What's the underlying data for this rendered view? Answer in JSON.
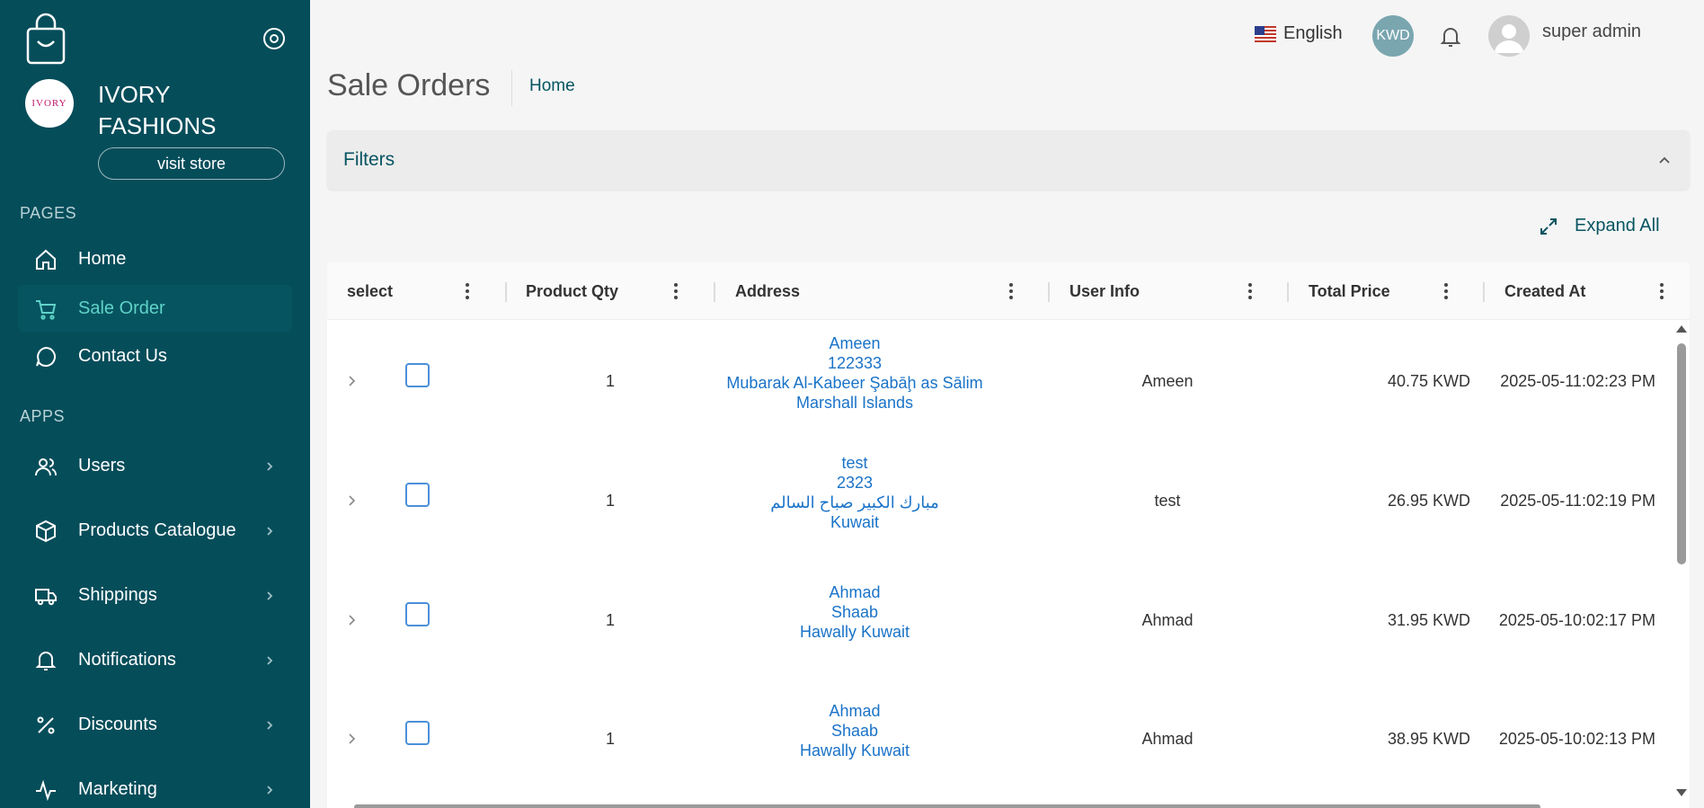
{
  "sidebar": {
    "brand_logo_text": "IVORY",
    "brand_name": "IVORY FASHIONS",
    "visit_store": "visit store",
    "pages_label": "PAGES",
    "apps_label": "APPS",
    "pages": [
      {
        "label": "Home",
        "icon": "home-icon"
      },
      {
        "label": "Sale Order",
        "icon": "cart-icon",
        "active": true
      },
      {
        "label": "Contact Us",
        "icon": "chat-icon"
      }
    ],
    "apps": [
      {
        "label": "Users",
        "icon": "users-icon"
      },
      {
        "label": "Products Catalogue",
        "icon": "box-icon"
      },
      {
        "label": "Shippings",
        "icon": "truck-icon"
      },
      {
        "label": "Notifications",
        "icon": "bell-icon"
      },
      {
        "label": "Discounts",
        "icon": "percent-icon"
      },
      {
        "label": "Marketing",
        "icon": "activity-icon"
      }
    ]
  },
  "header": {
    "language": "English",
    "currency": "KWD",
    "user_name": "super admin"
  },
  "page": {
    "title": "Sale Orders",
    "breadcrumb": "Home",
    "filters_label": "Filters",
    "expand_all": "Expand All"
  },
  "table": {
    "columns": [
      "select",
      "Product Qty",
      "Address",
      "User Info",
      "Total Price",
      "Created At"
    ],
    "rows": [
      {
        "qty": "1",
        "address": [
          "Ameen",
          "122333",
          "Mubarak Al-Kabeer Şabāḩ as Sālim",
          "Marshall Islands"
        ],
        "user": "Ameen",
        "price": "40.75 KWD",
        "created": "2025-05-11:02:23 PM"
      },
      {
        "qty": "1",
        "address": [
          "test",
          "2323",
          "مبارك الكبير صباح السالم",
          "Kuwait"
        ],
        "user": "test",
        "price": "26.95 KWD",
        "created": "2025-05-11:02:19 PM"
      },
      {
        "qty": "1",
        "address": [
          "Ahmad",
          "Shaab",
          "Hawally Kuwait"
        ],
        "user": "Ahmad",
        "price": "31.95 KWD",
        "created": "2025-05-10:02:17 PM"
      },
      {
        "qty": "1",
        "address": [
          "Ahmad",
          "Shaab",
          "Hawally Kuwait"
        ],
        "user": "Ahmad",
        "price": "38.95 KWD",
        "created": "2025-05-10:02:13 PM"
      }
    ]
  },
  "colors": {
    "sidebar_bg": "#064d5a",
    "active_text": "#5fd3c7",
    "link_blue": "#1a73c8",
    "currency_badge": "#7aa6b0"
  }
}
